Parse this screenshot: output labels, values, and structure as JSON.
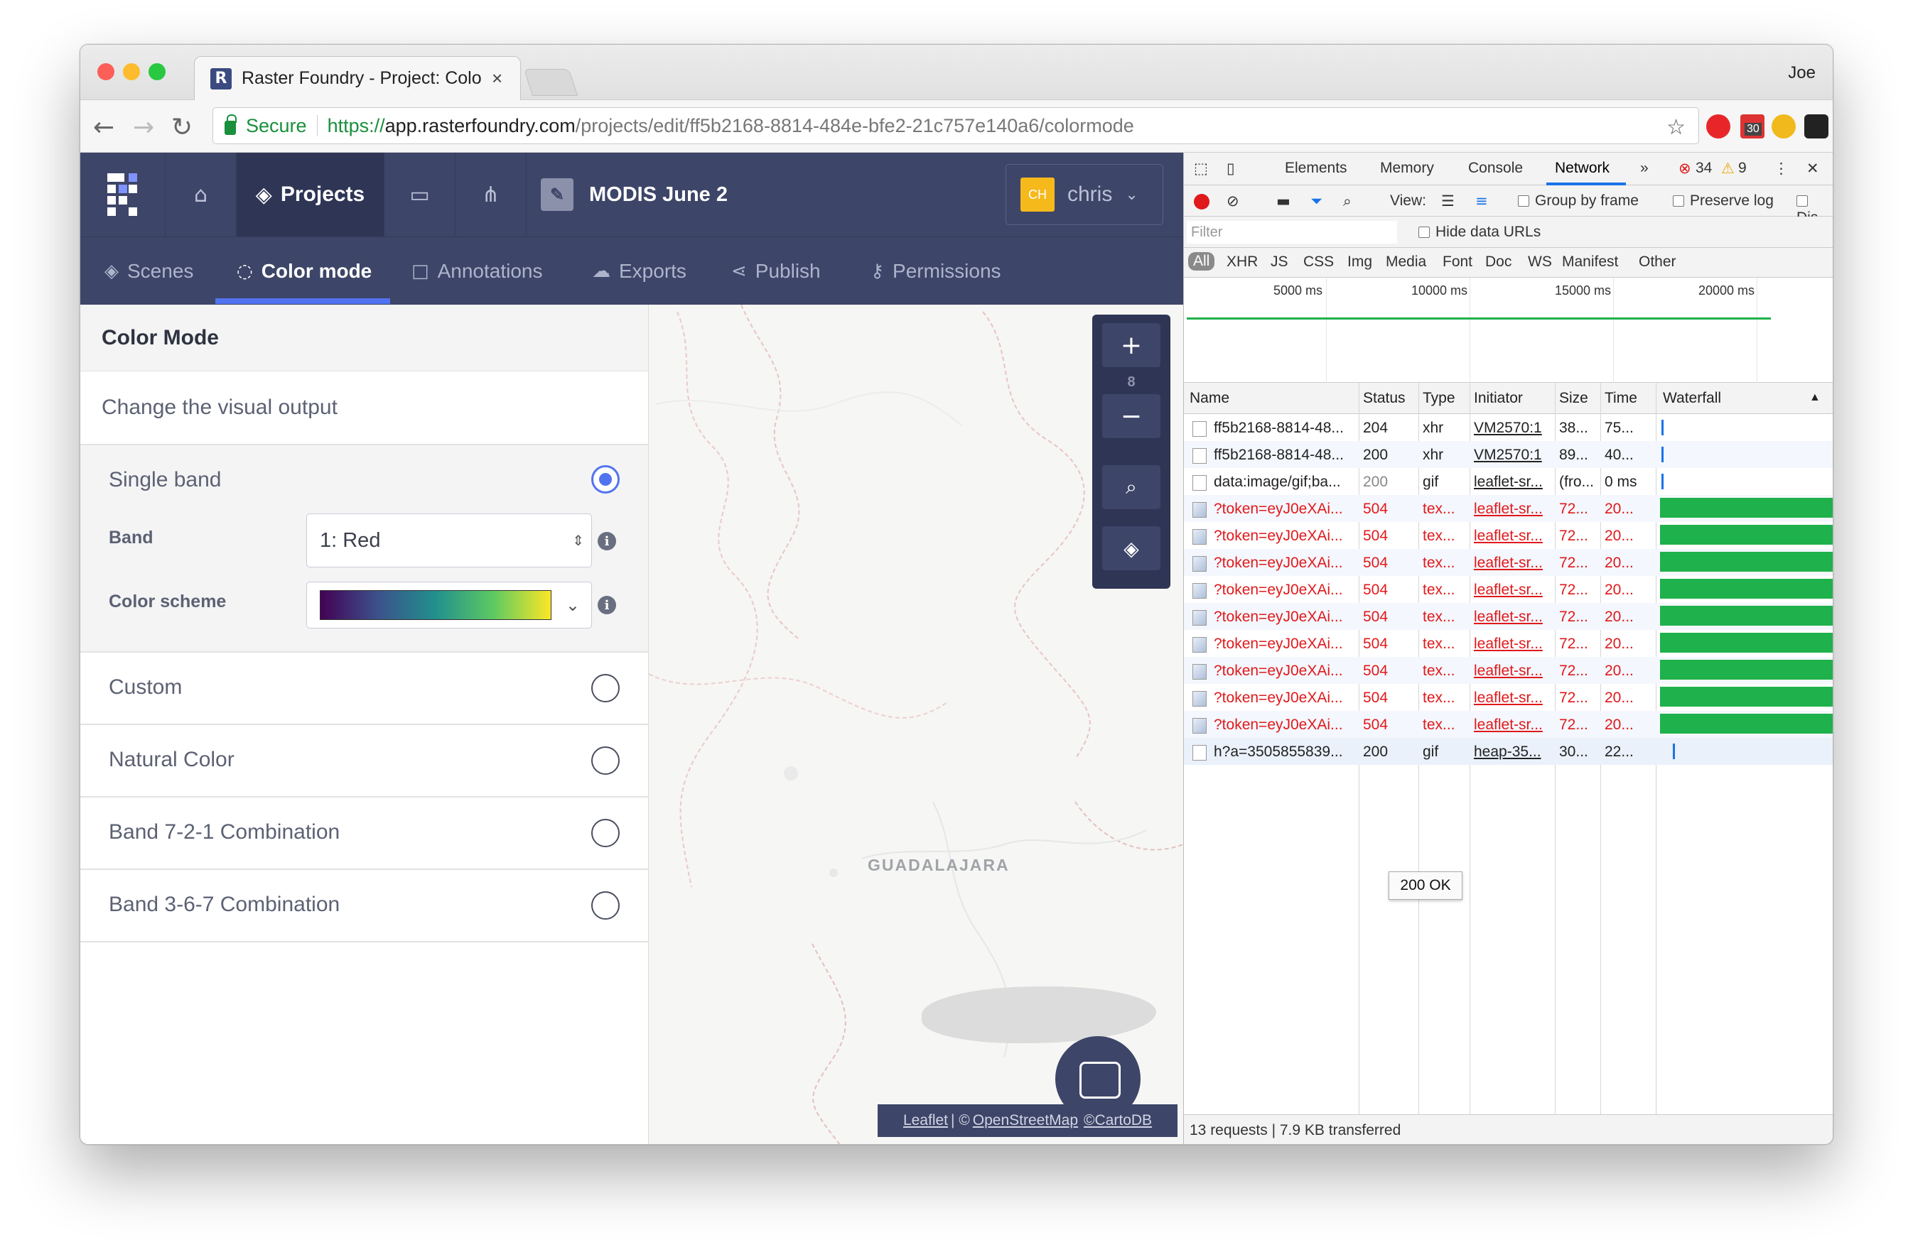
{
  "browser": {
    "tab_title": "Raster Foundry - Project: Colo",
    "tab_close": "×",
    "profile": "Joe",
    "secure_label": "Secure",
    "url_scheme": "https://",
    "url_host": "app.rasterfoundry.com",
    "url_path": "/projects/edit/ff5b2168-8814-484e-bfe2-21c757e140a6/colormode",
    "ext_badge": "30",
    "colors": {
      "close": "#fc5f57",
      "minimize": "#fdbc2e",
      "maximize": "#28c840"
    }
  },
  "app": {
    "nav": {
      "projects_label": "Projects",
      "project_name": "MODIS June 2",
      "user_initials": "CH",
      "user_name": "chris"
    },
    "subnav": [
      {
        "label": "Scenes",
        "icon": "layers-icon"
      },
      {
        "label": "Color mode",
        "icon": "color-mode-icon"
      },
      {
        "label": "Annotations",
        "icon": "annotation-icon"
      },
      {
        "label": "Exports",
        "icon": "cloud-icon"
      },
      {
        "label": "Publish",
        "icon": "share-icon"
      },
      {
        "label": "Permissions",
        "icon": "key-icon"
      }
    ],
    "sidebar": {
      "title": "Color Mode",
      "description": "Change the visual output",
      "single_band": {
        "label": "Single band",
        "band_label": "Band",
        "band_value": "1: Red",
        "scheme_label": "Color scheme",
        "selected": true
      },
      "options": [
        "Custom",
        "Natural Color",
        "Band 7-2-1 Combination",
        "Band 3-6-7 Combination"
      ]
    },
    "map": {
      "zoom_in": "+",
      "zoom_level": "8",
      "zoom_out": "−",
      "city": "GUADALAJARA",
      "attribution": {
        "leaflet": "Leaflet",
        "sep": "| ©",
        "osm": "OpenStreetMap",
        "cartodb": "©CartoDB"
      }
    },
    "accent": "#5273f0",
    "nav_bg": "#3d4568"
  },
  "devtools": {
    "tabs": [
      "Elements",
      "Memory",
      "Console",
      "Network"
    ],
    "more": "»",
    "errors": "34",
    "warnings": "9",
    "toolbar": {
      "view": "View:",
      "group_by_frame": "Group by frame",
      "preserve_log": "Preserve log",
      "disable": "Dis"
    },
    "filter_placeholder": "Filter",
    "hide_data_urls": "Hide data URLs",
    "types": [
      "All",
      "XHR",
      "JS",
      "CSS",
      "Img",
      "Media",
      "Font",
      "Doc",
      "WS",
      "Manifest",
      "Other"
    ],
    "timeline_ticks": [
      "5000 ms",
      "10000 ms",
      "15000 ms",
      "20000 ms"
    ],
    "columns": {
      "name": "Name",
      "status": "Status",
      "type": "Type",
      "initiator": "Initiator",
      "size": "Size",
      "time": "Time",
      "waterfall": "Waterfall",
      "sort": "▲"
    },
    "rows": [
      {
        "name": "ff5b2168-8814-48...",
        "status": "204",
        "type": "xhr",
        "initiator": "VM2570:1",
        "size": "38...",
        "time": "75...",
        "error": false
      },
      {
        "name": "ff5b2168-8814-48...",
        "status": "200",
        "type": "xhr",
        "initiator": "VM2570:1",
        "size": "89...",
        "time": "40...",
        "error": false
      },
      {
        "name": "data:image/gif;ba...",
        "status": "200",
        "type": "gif",
        "initiator": "leaflet-sr...",
        "size": "(fro...",
        "time": "0 ms",
        "error": false
      },
      {
        "name": "?token=eyJ0eXAi...",
        "status": "504",
        "type": "tex...",
        "initiator": "leaflet-sr...",
        "size": "72...",
        "time": "20...",
        "error": true
      },
      {
        "name": "?token=eyJ0eXAi...",
        "status": "504",
        "type": "tex...",
        "initiator": "leaflet-sr...",
        "size": "72...",
        "time": "20...",
        "error": true
      },
      {
        "name": "?token=eyJ0eXAi...",
        "status": "504",
        "type": "tex...",
        "initiator": "leaflet-sr...",
        "size": "72...",
        "time": "20...",
        "error": true
      },
      {
        "name": "?token=eyJ0eXAi...",
        "status": "504",
        "type": "tex...",
        "initiator": "leaflet-sr...",
        "size": "72...",
        "time": "20...",
        "error": true
      },
      {
        "name": "?token=eyJ0eXAi...",
        "status": "504",
        "type": "tex...",
        "initiator": "leaflet-sr...",
        "size": "72...",
        "time": "20...",
        "error": true
      },
      {
        "name": "?token=eyJ0eXAi...",
        "status": "504",
        "type": "tex...",
        "initiator": "leaflet-sr...",
        "size": "72...",
        "time": "20...",
        "error": true
      },
      {
        "name": "?token=eyJ0eXAi...",
        "status": "504",
        "type": "tex...",
        "initiator": "leaflet-sr...",
        "size": "72...",
        "time": "20...",
        "error": true
      },
      {
        "name": "?token=eyJ0eXAi...",
        "status": "504",
        "type": "tex...",
        "initiator": "leaflet-sr...",
        "size": "72...",
        "time": "20...",
        "error": true
      },
      {
        "name": "?token=eyJ0eXAi...",
        "status": "504",
        "type": "tex...",
        "initiator": "leaflet-sr...",
        "size": "72...",
        "time": "20...",
        "error": true
      },
      {
        "name": "h?a=3505855839...",
        "status": "200",
        "type": "gif",
        "initiator": "heap-35...",
        "size": "30...",
        "time": "22...",
        "error": false
      }
    ],
    "tooltip": "200 OK",
    "summary": "13 requests | 7.9 KB transferred"
  }
}
